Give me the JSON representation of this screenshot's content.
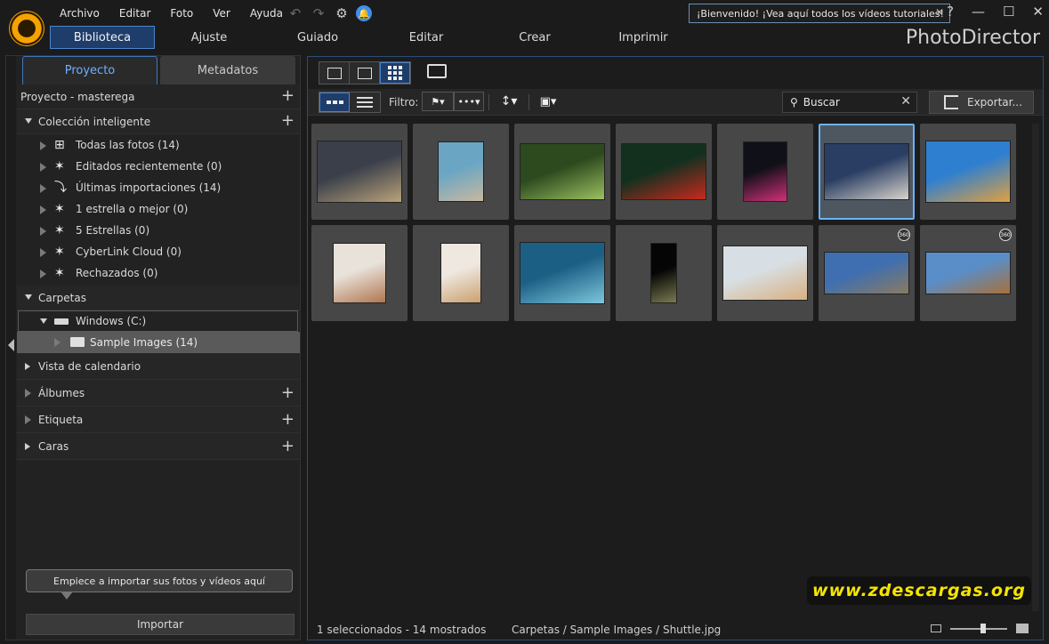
{
  "menu": [
    "Archivo",
    "Editar",
    "Foto",
    "Ver",
    "Ayuda"
  ],
  "welcome_text": "¡Bienvenido! ¡Vea aquí todos los vídeos tutoriales!",
  "app_name": "PhotoDirector",
  "modes": [
    "Biblioteca",
    "Ajuste",
    "Guiado",
    "Editar",
    "Crear",
    "Imprimir"
  ],
  "left_tabs": [
    "Proyecto",
    "Metadatos"
  ],
  "project_label": "Proyecto - masterega",
  "smart_collection": {
    "title": "Colección inteligente",
    "items": [
      {
        "icon": "hierarchy-icon",
        "label": "Todas las fotos (14)"
      },
      {
        "icon": "magic-wand-icon",
        "label": "Editados recientemente (0)"
      },
      {
        "icon": "import-arrow-icon",
        "label": "Últimas importaciones (14)"
      },
      {
        "icon": "magic-wand-icon",
        "label": "1 estrella o mejor (0)"
      },
      {
        "icon": "magic-wand-icon",
        "label": "5 Estrellas (0)"
      },
      {
        "icon": "magic-wand-icon",
        "label": "CyberLink Cloud (0)"
      },
      {
        "icon": "magic-wand-icon",
        "label": "Rechazados (0)"
      }
    ]
  },
  "folders": {
    "title": "Carpetas",
    "drive": "Windows (C:)",
    "folder": "Sample Images (14)"
  },
  "calendar": "Vista de calendario",
  "albums": "Álbumes",
  "tags": "Etiqueta",
  "faces": "Caras",
  "tooltip": "Empiece a importar sus fotos y vídeos aquí",
  "import_button": "Importar",
  "filter_label": "Filtro:",
  "search_placeholder": "Buscar",
  "export_button": "Exportar...",
  "photos": [
    {
      "name": "basketball",
      "c1": "#3a3f4a",
      "c2": "#b9a27a"
    },
    {
      "name": "rock-boat",
      "c1": "#6aa6c4",
      "c2": "#c8b8a0"
    },
    {
      "name": "forest",
      "c1": "#2c4a1e",
      "c2": "#9cc060"
    },
    {
      "name": "red-leaf",
      "c1": "#13301f",
      "c2": "#c8291e"
    },
    {
      "name": "neon-sign",
      "c1": "#101018",
      "c2": "#d0307a"
    },
    {
      "name": "shuttle",
      "c1": "#2a3e63",
      "c2": "#d8d4cc"
    },
    {
      "name": "skateboarder",
      "c1": "#2f7fd0",
      "c2": "#e0a040"
    },
    {
      "name": "woman-smiling-1",
      "c1": "#e8e2da",
      "c2": "#b07650"
    },
    {
      "name": "woman-smiling-2",
      "c1": "#efe8e0",
      "c2": "#caa070"
    },
    {
      "name": "wave",
      "c1": "#1b5f85",
      "c2": "#7ec6dc"
    },
    {
      "name": "window-light",
      "c1": "#050505",
      "c2": "#7a7a50"
    },
    {
      "name": "woman-blonde",
      "c1": "#d8dfe4",
      "c2": "#d8b080"
    },
    {
      "name": "panorama-360-1",
      "c1": "#3f6fb0",
      "c2": "#8a7a60"
    },
    {
      "name": "panorama-360-2",
      "c1": "#5a8ec8",
      "c2": "#a8703a"
    }
  ],
  "badge_360": "360",
  "status": {
    "selection": "1 seleccionados - 14 mostrados",
    "path": "Carpetas / Sample Images / Shuttle.jpg"
  },
  "watermark": "www.zdescargas.org"
}
